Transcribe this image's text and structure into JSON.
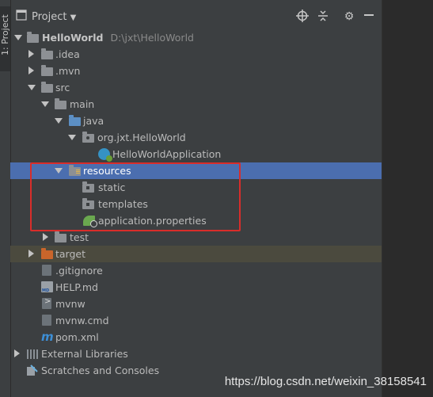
{
  "strip": {
    "label": "1: Project"
  },
  "toolbar": {
    "title": "Project"
  },
  "tree": {
    "root": {
      "name": "HelloWorld",
      "path": "D:\\jxt\\HelloWorld"
    },
    "idea": ".idea",
    "mvn": ".mvn",
    "src": "src",
    "main": "main",
    "java": "java",
    "package": "org.jxt.HelloWorld",
    "app_class": "HelloWorldApplication",
    "resources": "resources",
    "static": "static",
    "templates": "templates",
    "props": "application.properties",
    "test": "test",
    "target": "target",
    "gitignore": ".gitignore",
    "help": "HELP.md",
    "mvnw": "mvnw",
    "mvnw_cmd": "mvnw.cmd",
    "pom": "pom.xml",
    "external": "External Libraries",
    "scratches": "Scratches and Consoles"
  },
  "watermark": "https://blog.csdn.net/weixin_38158541",
  "colors": {
    "selection": "#4b6eaf",
    "highlight_box": "#d92d2a",
    "excluded_band": "#4b4a3e"
  }
}
